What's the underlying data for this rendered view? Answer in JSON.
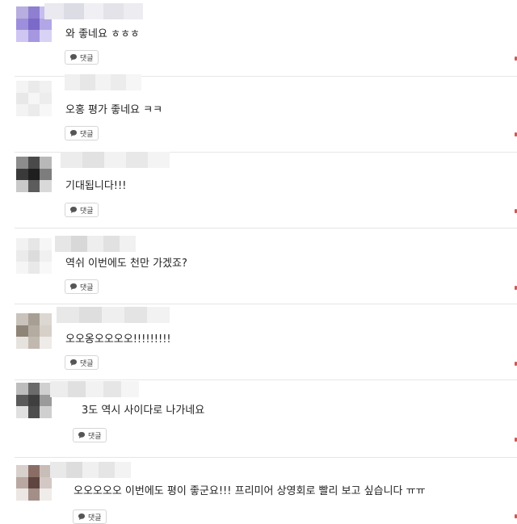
{
  "reply_label": "댓글",
  "comments": [
    {
      "text": "와 좋네요 ㅎㅎㅎ",
      "avatar": [
        "#b9aee0",
        "#8e7fd0",
        "#c6bdf0",
        "#9d8fdb",
        "#7c6ac9",
        "#b3a6e6",
        "#cfc6f2",
        "#a697e0",
        "#d8d2f5"
      ],
      "name": [
        "#e9e9ef",
        "#dcdce4",
        "#f0f0f4",
        "#e3e3e9",
        "#ececf1"
      ]
    },
    {
      "text": "오홍 평가 좋네요 ㅋㅋ",
      "avatar": [
        "#f4f4f4",
        "#eaeaea",
        "#f1f1f1",
        "#e8e8e8",
        "#f6f6f6",
        "#ededed",
        "#f3f3f3",
        "#ebebeb",
        "#f7f7f7"
      ],
      "name": [
        "#f0f0f0",
        "#e7e7e7",
        "#f3f3f3",
        "#ececec",
        "#f6f6f6"
      ]
    },
    {
      "text": "기대됩니다!!!",
      "avatar": [
        "#8c8c8c",
        "#4a4a4a",
        "#b8b8b8",
        "#3a3a3a",
        "#1f1f1f",
        "#7d7d7d",
        "#c9c9c9",
        "#5c5c5c",
        "#d9d9d9"
      ],
      "name": [
        "#ececec",
        "#e2e2e2",
        "#f2f2f2",
        "#e8e8e8",
        "#f4f4f4"
      ]
    },
    {
      "text": "역쉬 이번에도 천만 가겠죠?",
      "avatar": [
        "#f2f2f2",
        "#e6e6e6",
        "#f6f6f6",
        "#ebebeb",
        "#dcdcdc",
        "#f0f0f0",
        "#f5f5f5",
        "#e9e9e9",
        "#f8f8f8"
      ],
      "name": [
        "#e6e6e6",
        "#d8d8d8",
        "#eeeeee",
        "#e1e1e1",
        "#f1f1f1"
      ]
    },
    {
      "text": "오오옹오오오오!!!!!!!!!",
      "avatar": [
        "#c9c3bc",
        "#a89f94",
        "#dcd7d1",
        "#8f8478",
        "#b4aba1",
        "#d6d0c9",
        "#e6e3df",
        "#c1b9b0",
        "#eeebe8"
      ],
      "name": [
        "#e8e8e8",
        "#dedede",
        "#efefef",
        "#e4e4e4",
        "#f2f2f2"
      ]
    },
    {
      "text": "3도 역시 사이다로 나가네요",
      "avatar": [
        "#bdbdbd",
        "#6b6b6b",
        "#d0d0d0",
        "#5a5a5a",
        "#3f3f3f",
        "#9a9a9a",
        "#e0e0e0",
        "#4d4d4d",
        "#cfcfcf"
      ],
      "name": [
        "#ededed",
        "#e0e0e0",
        "#f2f2f2",
        "#e6e6e6",
        "#f5f5f5"
      ]
    },
    {
      "text": "오오오오오 이번에도 평이 좋군요!!! 프리미어 상영회로 빨리 보고 싶습니다 ㅠㅠ",
      "avatar": [
        "#d8d0cc",
        "#8a6e66",
        "#c9bdb8",
        "#b9a8a2",
        "#5e4540",
        "#d4c8c4",
        "#ece6e4",
        "#a38e88",
        "#f0ecea"
      ],
      "name": [
        "#e9e9e9",
        "#dddddd",
        "#f0f0f0",
        "#e5e5e5",
        "#f3f3f3"
      ]
    }
  ]
}
